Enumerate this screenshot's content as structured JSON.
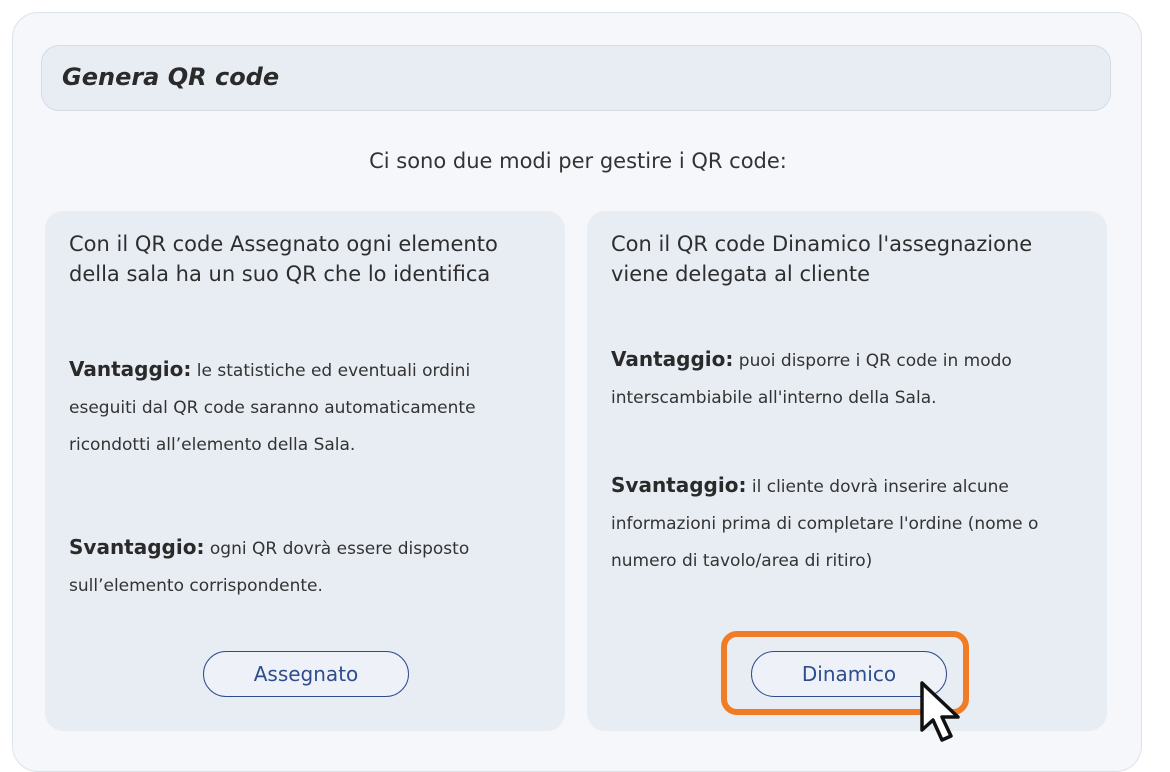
{
  "header": {
    "title": "Genera QR code"
  },
  "intro": "Ci sono due modi per gestire i QR code:",
  "cards": [
    {
      "title": "Con il QR code Assegnato ogni elemento della sala ha un suo QR che lo identifica",
      "advantage_label": "Vantaggio:",
      "advantage_text": " le statistiche ed eventuali ordini eseguiti dal QR code saranno automaticamente ricondotti all’elemento della Sala.",
      "disadvantage_label": "Svantaggio:",
      "disadvantage_text": " ogni QR dovrà essere disposto sull’elemento corrispondente.",
      "button_label": "Assegnato"
    },
    {
      "title": "Con il QR code Dinamico l'assegnazione viene delegata al cliente",
      "advantage_label": "Vantaggio:",
      "advantage_text": " puoi disporre i QR code in modo interscambiabile all'interno della Sala.",
      "disadvantage_label": "Svantaggio:",
      "disadvantage_text": " il cliente dovrà inserire alcune informazioni prima di completare l'ordine (nome o numero di tavolo/area di ritiro)",
      "button_label": "Dinamico"
    }
  ],
  "colors": {
    "panel_bg": "#f5f7fb",
    "card_bg": "#e8edf4",
    "button_accent": "#2e4d8d",
    "highlight": "#f07c26"
  },
  "icons": {
    "cursor": "arrow-cursor-icon"
  }
}
